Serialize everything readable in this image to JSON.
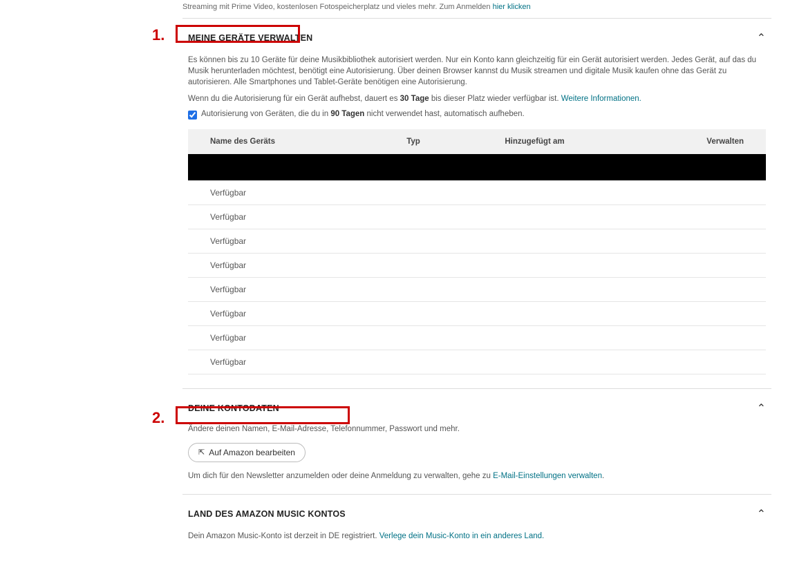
{
  "top": {
    "line1": "Streaming mit Prime Video, kostenlosen Fotospeicherplatz und vieles mehr. Zum Anmelden ",
    "link": "hier klicken"
  },
  "annotations": {
    "a1": "1.",
    "a2": "2."
  },
  "section_devices": {
    "title": "MEINE GERÄTE VERWALTEN",
    "p1": "Es können bis zu 10 Geräte für deine Musikbibliothek autorisiert werden. Nur ein Konto kann gleichzeitig für ein Gerät autorisiert werden. Jedes Gerät, auf das du Musik herunterladen möchtest, benötigt eine Autorisierung. Über deinen Browser kannst du Musik streamen und digitale Musik kaufen ohne das Gerät zu autorisieren. Alle Smartphones und Tablet-Geräte benötigen eine Autorisierung.",
    "p2_pre": "Wenn du die Autorisierung für ein Gerät aufhebst, dauert es ",
    "p2_bold": "30 Tage",
    "p2_post": " bis dieser Platz wieder verfügbar ist. ",
    "p2_link": "Weitere Informationen.",
    "checkbox_pre": "Autorisierung von Geräten, die du in ",
    "checkbox_bold": "90 Tagen",
    "checkbox_post": " nicht verwendet hast, automatisch aufheben.",
    "table": {
      "col1": "Name des Geräts",
      "col2": "Typ",
      "col3": "Hinzugefügt am",
      "col4": "Verwalten",
      "row1_redacted": true,
      "rows": [
        "Verfügbar",
        "Verfügbar",
        "Verfügbar",
        "Verfügbar",
        "Verfügbar",
        "Verfügbar",
        "Verfügbar",
        "Verfügbar"
      ]
    }
  },
  "section_account": {
    "title": "DEINE KONTODATEN",
    "p1": "Ändere deinen Namen, E-Mail-Adresse, Telefonnummer, Passwort und mehr.",
    "button_label": "Auf Amazon bearbeiten",
    "newsletter_pre": "Um dich für den Newsletter anzumelden oder deine Anmeldung zu verwalten, gehe zu ",
    "newsletter_link": "E-Mail-Einstellungen verwalten",
    "newsletter_post": "."
  },
  "section_country": {
    "title": "LAND DES AMAZON MUSIC KONTOS",
    "p1_pre": "Dein Amazon Music-Konto ist derzeit in DE registriert. ",
    "p1_link": "Verlege dein Music-Konto in ein anderes Land.",
    "p1_post": ""
  }
}
